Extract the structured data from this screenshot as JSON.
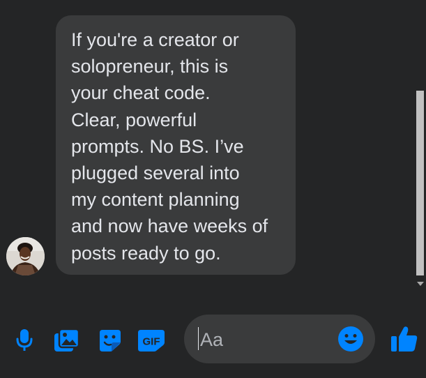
{
  "colors": {
    "background": "#242526",
    "bubble": "#3a3b3c",
    "text": "#e4e6eb",
    "accent": "#0084ff",
    "placeholder": "#b0b3b8"
  },
  "message": {
    "lines": [
      "If you're a creator or",
      "solopreneur, this is",
      "your cheat code.",
      "Clear, powerful",
      "prompts. No BS. I’ve",
      "plugged several into",
      "my content planning",
      "and now have weeks of",
      "posts ready to go."
    ]
  },
  "composer": {
    "icons": [
      "microphone-icon",
      "photo-icon",
      "sticker-icon",
      "gif-icon",
      "emoji-icon",
      "thumbs-up-icon"
    ],
    "gif_label": "GIF",
    "input_placeholder": "Aa"
  }
}
